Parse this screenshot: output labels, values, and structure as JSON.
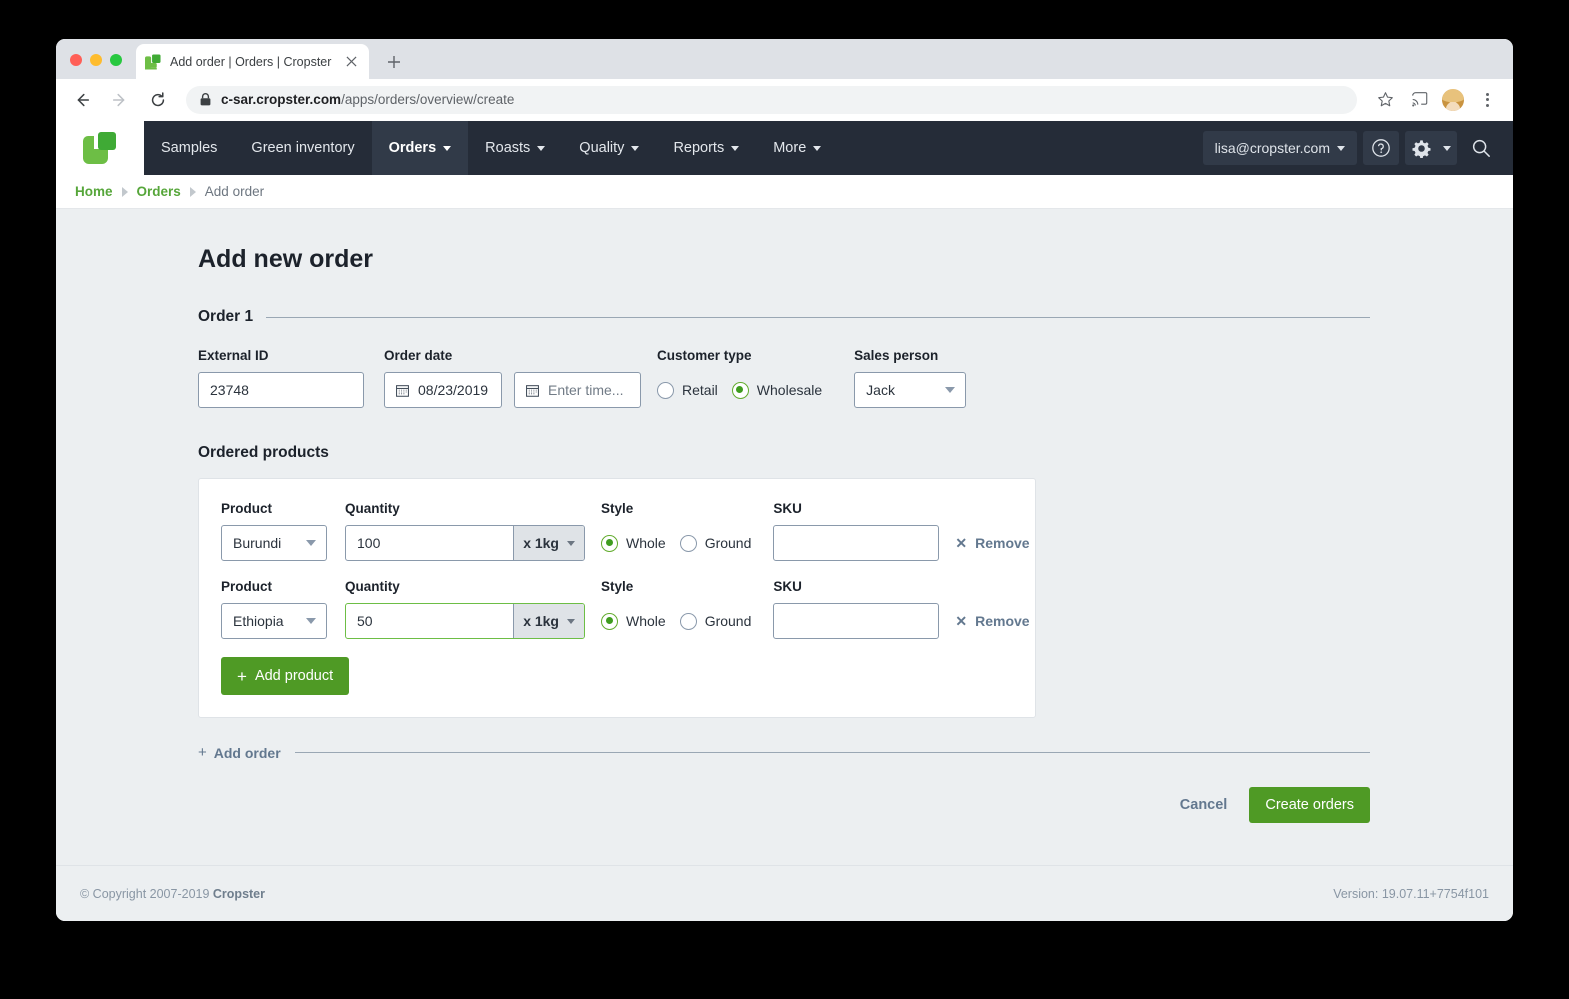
{
  "browser": {
    "tab_title": "Add order | Orders | Cropster",
    "tab_close_icon": "close-icon",
    "new_tab_icon": "plus-icon",
    "url_host": "c-sar.cropster.com",
    "url_path": "/apps/orders/overview/create",
    "back_icon": "back-arrow-icon",
    "forward_icon": "forward-arrow-icon",
    "reload_icon": "reload-icon",
    "lock_icon": "lock-icon",
    "star_icon": "star-icon",
    "cast_icon": "cast-icon",
    "avatar_icon": "profile-avatar",
    "menu_icon": "kebab-menu-icon"
  },
  "topnav": {
    "logo_name": "cropster-logo",
    "items": [
      {
        "label": "Samples",
        "has_caret": false,
        "active": false
      },
      {
        "label": "Green inventory",
        "has_caret": false,
        "active": false
      },
      {
        "label": "Orders",
        "has_caret": true,
        "active": true
      },
      {
        "label": "Roasts",
        "has_caret": true,
        "active": false
      },
      {
        "label": "Quality",
        "has_caret": true,
        "active": false
      },
      {
        "label": "Reports",
        "has_caret": true,
        "active": false
      },
      {
        "label": "More",
        "has_caret": true,
        "active": false
      }
    ],
    "user_email": "lisa@cropster.com",
    "help_icon": "help-circle-icon",
    "settings_icon": "gear-icon",
    "search_icon": "search-icon"
  },
  "breadcrumb": {
    "home": "Home",
    "orders": "Orders",
    "current": "Add order"
  },
  "page": {
    "title": "Add new order",
    "order_section_label": "Order 1",
    "ordered_products_label": "Ordered products"
  },
  "order_fields": {
    "external_id": {
      "label": "External ID",
      "value": "23748"
    },
    "order_date": {
      "label": "Order date",
      "value": "08/23/2019",
      "icon": "calendar-icon"
    },
    "order_time": {
      "placeholder": "Enter time...",
      "icon": "calendar-icon"
    },
    "customer_type": {
      "label": "Customer type",
      "options": [
        "Retail",
        "Wholesale"
      ],
      "selected": "Wholesale"
    },
    "sales_person": {
      "label": "Sales person",
      "value": "Jack"
    }
  },
  "products_table": {
    "headers": {
      "product": "Product",
      "quantity": "Quantity",
      "style": "Style",
      "sku": "SKU"
    },
    "style_options": [
      "Whole",
      "Ground"
    ],
    "remove_label": "Remove",
    "remove_icon": "close-x-icon",
    "rows": [
      {
        "product": "Burundi",
        "quantity": "100",
        "unit": "x 1kg",
        "style_selected": "Whole",
        "sku": "",
        "focused": false
      },
      {
        "product": "Ethiopia",
        "quantity": "50",
        "unit": "x 1kg",
        "style_selected": "Whole",
        "sku": "",
        "focused": true
      }
    ],
    "add_product_label": "Add product",
    "add_product_plus": "+"
  },
  "footer_actions": {
    "add_order_label": "Add order",
    "add_order_plus": "+",
    "cancel_label": "Cancel",
    "create_label": "Create orders"
  },
  "footer": {
    "copyright_prefix": "© Copyright 2007-2019 ",
    "copyright_brand": "Cropster",
    "version": "Version: 19.07.11+7754f101"
  },
  "colors": {
    "brand_green": "#4f9a25",
    "link_green": "#56a63a",
    "nav_dark": "#252c38",
    "nav_active": "#313a48",
    "page_bg": "#eceff1",
    "slate": "#63788f"
  }
}
